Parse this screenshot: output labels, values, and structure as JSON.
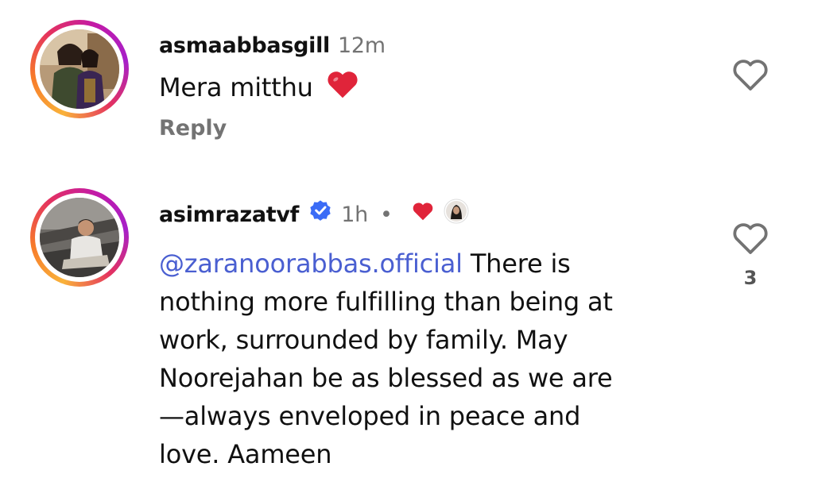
{
  "comments": [
    {
      "username": "asmaabbasgill",
      "time": "12m",
      "text": "Mera mitthu",
      "emoji_icon": "red-heart-emoji",
      "reply_label": "Reply",
      "like_icon": "heart-outline-icon"
    },
    {
      "username": "asimrazatvf",
      "verified_icon": "verified-badge-icon",
      "time": "1h",
      "separator": "•",
      "liked_by_creator_icon": "red-heart-icon",
      "mention": "@zaranoorabbas.official",
      "text_lines": [
        " There is",
        "nothing more fulfilling than being at",
        "work, surrounded by family. May",
        "Noorejahan be as blessed as we are",
        "—always enveloped in peace and",
        "love. Aameen"
      ],
      "like_icon": "heart-outline-icon",
      "like_count": "3"
    }
  ],
  "colors": {
    "mention": "#4a5fd1",
    "muted": "#737373",
    "heart_red": "#e0243a",
    "verified_blue": "#3b6cf6"
  }
}
